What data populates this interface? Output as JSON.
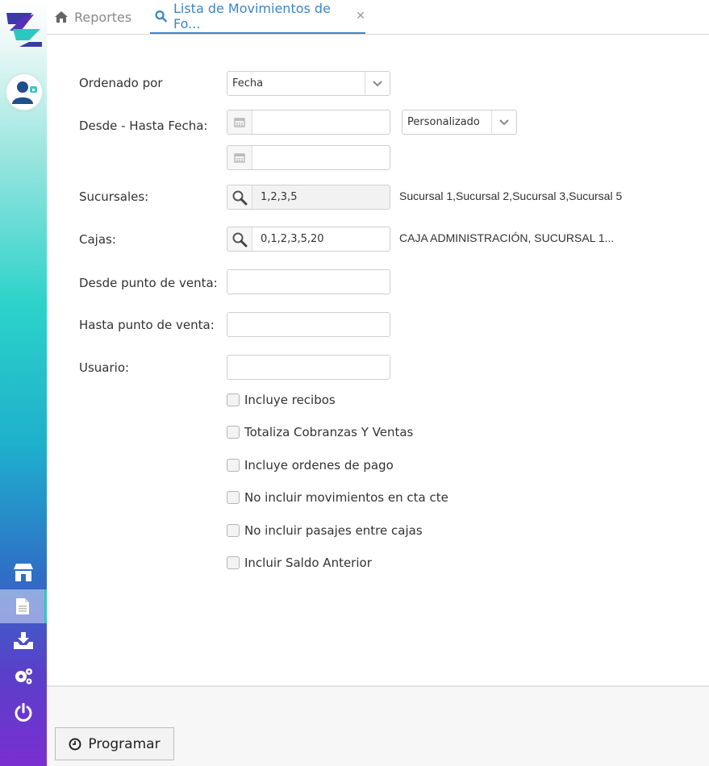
{
  "tabs": [
    {
      "label": "Reportes",
      "icon": "home-icon"
    },
    {
      "label": "Lista de Movimientos de Fo...",
      "icon": "search-icon",
      "closable": true
    }
  ],
  "form": {
    "ordenado_por": {
      "label": "Ordenado por",
      "value": "Fecha"
    },
    "fecha": {
      "label": "Desde - Hasta Fecha:",
      "desde": "",
      "hasta": "",
      "rango": "Personalizado"
    },
    "sucursales": {
      "label": "Sucursales:",
      "value": "1,2,3,5",
      "description": "Sucursal 1,Sucursal 2,Sucursal 3,Sucursal 5"
    },
    "cajas": {
      "label": "Cajas:",
      "value": "0,1,2,3,5,20",
      "description": "CAJA ADMINISTRACIÓN, SUCURSAL 1..."
    },
    "desde_punto": {
      "label": "Desde punto de venta:",
      "value": ""
    },
    "hasta_punto": {
      "label": "Hasta punto de venta:",
      "value": ""
    },
    "usuario": {
      "label": "Usuario:",
      "value": ""
    },
    "checks": [
      {
        "label": "Incluye recibos",
        "checked": false
      },
      {
        "label": "Totaliza Cobranzas Y Ventas",
        "checked": false
      },
      {
        "label": "Incluye ordenes de pago",
        "checked": false
      },
      {
        "label": "No incluir movimientos en cta cte",
        "checked": false
      },
      {
        "label": "No incluir pasajes entre cajas",
        "checked": false
      },
      {
        "label": "Incluir Saldo Anterior",
        "checked": false
      }
    ]
  },
  "footer": {
    "programar_label": "Programar"
  },
  "colors": {
    "accent": "#3a86c8"
  }
}
